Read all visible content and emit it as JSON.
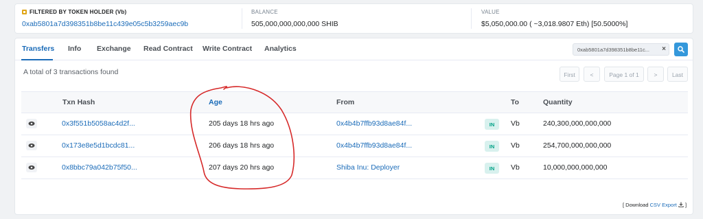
{
  "summary_bar": {
    "holder_label": "FILTERED BY TOKEN HOLDER (Vb)",
    "holder_address": "0xab5801a7d398351b8be11c439e05c5b3259aec9b",
    "balance_label": "BALANCE",
    "balance_value": "505,000,000,000,000 SHIB",
    "value_label": "VALUE",
    "value_value": "$5,050,000.00 ( ~3,018.9807 Eth) [50.5000%]"
  },
  "tabs": [
    {
      "label": "Transfers"
    },
    {
      "label": "Info"
    },
    {
      "label": "Exchange"
    },
    {
      "label": "Read Contract"
    },
    {
      "label": "Write Contract"
    },
    {
      "label": "Analytics"
    }
  ],
  "filter": {
    "chip_text": "0xab5801a7d398351b8be11c...",
    "close_glyph": "×"
  },
  "summary_text": "A total of 3 transactions found",
  "pagination": {
    "first": "First",
    "prev": "<",
    "info": "Page 1 of 1",
    "next": ">",
    "last": "Last"
  },
  "table": {
    "headers": {
      "txn_hash": "Txn Hash",
      "age": "Age",
      "from": "From",
      "to": "To",
      "quantity": "Quantity"
    },
    "rows": [
      {
        "hash": "0x3f551b5058ac4d2f...",
        "age": "205 days 18 hrs ago",
        "from": "0x4b4b7ffb93d8ae84f...",
        "direction": "IN",
        "to": "Vb",
        "quantity": "240,300,000,000,000"
      },
      {
        "hash": "0x173e8e5d1bcdc81...",
        "age": "206 days 18 hrs ago",
        "from": "0x4b4b7ffb93d8ae84f...",
        "direction": "IN",
        "to": "Vb",
        "quantity": "254,700,000,000,000"
      },
      {
        "hash": "0x8bbc79a042b75f50...",
        "age": "207 days 20 hrs ago",
        "from": "Shiba Inu: Deployer",
        "direction": "IN",
        "to": "Vb",
        "quantity": "10,000,000,000,000"
      }
    ]
  },
  "export": {
    "prefix": "[ Download",
    "link": "CSV Export"
  },
  "icons": {
    "filter": "filter-icon",
    "search": "search-icon",
    "eye": "eye-icon",
    "download": "download-icon"
  },
  "colors": {
    "link_blue": "#1a6bb8",
    "in_badge_bg": "#d8f1ee",
    "in_badge_text": "#00a186",
    "annotation_red": "#d62828"
  }
}
